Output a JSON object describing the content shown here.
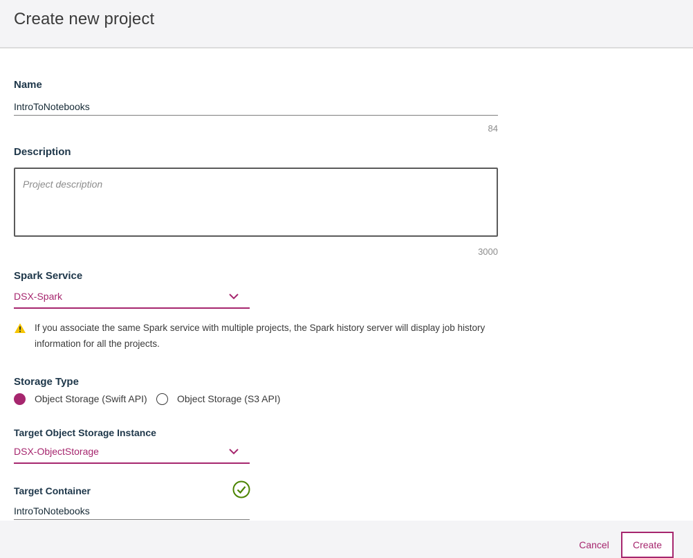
{
  "dialog": {
    "title": "Create new project"
  },
  "name": {
    "label": "Name",
    "value": "IntroToNotebooks",
    "remaining": "84"
  },
  "description": {
    "label": "Description",
    "placeholder": "Project description",
    "remaining": "3000"
  },
  "spark": {
    "label": "Spark Service",
    "selected": "DSX-Spark",
    "warning": "If you associate the same Spark service with multiple projects, the Spark history server will display job history information for all the projects."
  },
  "storage_type": {
    "label": "Storage Type",
    "options": [
      {
        "label": "Object Storage (Swift API)",
        "checked": true
      },
      {
        "label": "Object Storage (S3 API)",
        "checked": false
      }
    ]
  },
  "target_instance": {
    "label": "Target Object Storage Instance",
    "selected": "DSX-ObjectStorage"
  },
  "target_container": {
    "label": "Target Container",
    "value": "IntroToNotebooks"
  },
  "footer": {
    "cancel_label": "Cancel",
    "create_label": "Create"
  },
  "colors": {
    "accent": "#a6266e",
    "warning": "#f5c400",
    "success": "#4b8400"
  },
  "icons": {
    "chevron": "chevron-down-icon",
    "warning": "warning-icon",
    "success": "check-circle-icon"
  }
}
